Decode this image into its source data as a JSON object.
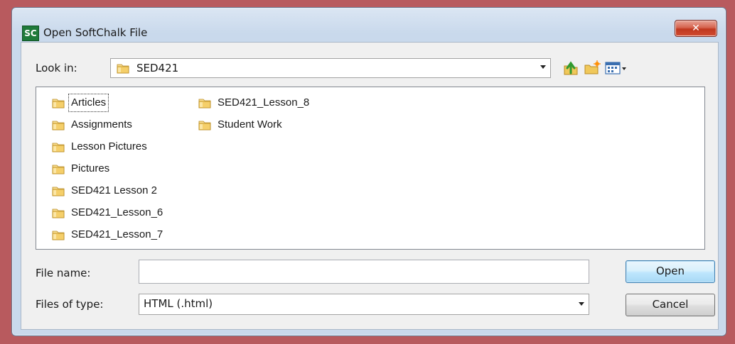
{
  "window": {
    "app_icon_text": "SC",
    "title": "Open SoftChalk File",
    "close_glyph": "✕"
  },
  "look_in": {
    "label": "Look in:",
    "value": "SED421",
    "icon": "folder-icon"
  },
  "toolbar": {
    "up_icon": "up-one-level-icon",
    "new_folder_icon": "new-folder-icon",
    "view_menu_icon": "view-menu-icon"
  },
  "files": {
    "column1": [
      {
        "label": "Articles",
        "icon": "folder-icon"
      },
      {
        "label": "Assignments",
        "icon": "folder-icon"
      },
      {
        "label": "Lesson Pictures",
        "icon": "folder-icon"
      },
      {
        "label": "Pictures",
        "icon": "folder-icon"
      },
      {
        "label": "SED421 Lesson 2",
        "icon": "folder-icon"
      },
      {
        "label": "SED421_Lesson_6",
        "icon": "folder-icon"
      },
      {
        "label": "SED421_Lesson_7",
        "icon": "folder-icon"
      }
    ],
    "column2": [
      {
        "label": "SED421_Lesson_8",
        "icon": "folder-icon"
      },
      {
        "label": "Student Work",
        "icon": "folder-icon"
      }
    ]
  },
  "file_name": {
    "label": "File name:",
    "value": "",
    "placeholder": ""
  },
  "file_type": {
    "label": "Files of type:",
    "value": "HTML (.html)"
  },
  "buttons": {
    "open": "Open",
    "cancel": "Cancel"
  },
  "colors": {
    "frame": "#b85a5e",
    "title_bg": "#c9d9ec",
    "folder": "#e8b84a",
    "close": "#c9452e"
  }
}
